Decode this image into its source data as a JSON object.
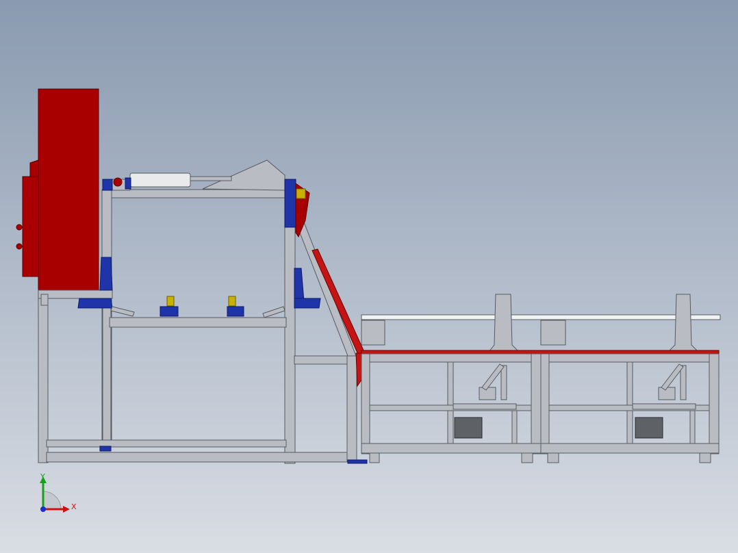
{
  "viewport": {
    "background_top": "#8a9ab0",
    "background_bottom": "#d9dde4"
  },
  "model": {
    "colors": {
      "frame": "#b9bdc3",
      "frame_edge": "#555a60",
      "housing": "#a80000",
      "housing_edge": "#5a0000",
      "bracket": "#1f34a8",
      "clamp": "#c7b100",
      "ramp": "#c41414",
      "table_top": "#c41414",
      "cylinder": "#e8eaec",
      "motor": "#5e6166",
      "shaft": "#f1f2f3"
    }
  },
  "triad": {
    "x_label": "X",
    "y_label": "Y",
    "x_color": "#d01010",
    "y_color": "#18a018",
    "z_color": "#1a2ed0"
  }
}
